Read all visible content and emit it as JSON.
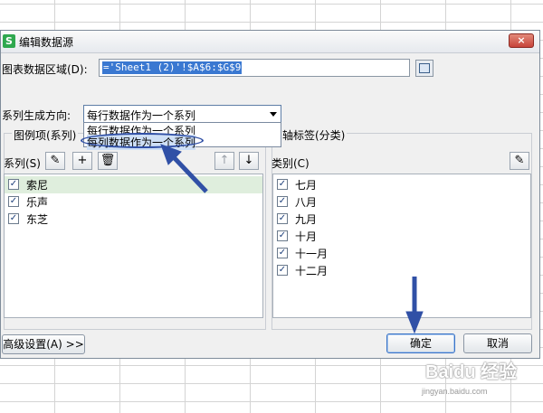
{
  "dialog": {
    "title": "编辑数据源",
    "app_icon_letter": "S",
    "close_label": "×"
  },
  "range": {
    "label": "图表数据区域(D):",
    "value": "='Sheet1 (2)'!$A$6:$G$9"
  },
  "direction": {
    "label": "系列生成方向:",
    "selected": "每行数据作为一个系列",
    "options": [
      "每行数据作为一个系列",
      "每列数据作为一个系列"
    ]
  },
  "legend_group": {
    "title": "图例项(系列)",
    "series_label": "系列(S)",
    "items": [
      {
        "label": "索尼",
        "checked": true,
        "selected": true
      },
      {
        "label": "乐声",
        "checked": true,
        "selected": false
      },
      {
        "label": "东芝",
        "checked": true,
        "selected": false
      }
    ]
  },
  "axis_group": {
    "title": "轴标签(分类)",
    "category_label": "类别(C)",
    "items": [
      {
        "label": "七月",
        "checked": true
      },
      {
        "label": "八月",
        "checked": true
      },
      {
        "label": "九月",
        "checked": true
      },
      {
        "label": "十月",
        "checked": true
      },
      {
        "label": "十一月",
        "checked": true
      },
      {
        "label": "十二月",
        "checked": true
      }
    ]
  },
  "footer": {
    "advanced_label": "高级设置(A) >>",
    "ok_label": "确定",
    "cancel_label": "取消"
  },
  "watermark": {
    "site": "jingyan.baidu.com",
    "brand": "Baidu 经验"
  },
  "colors": {
    "accent": "#3a78d1",
    "annotation": "#3050a6"
  }
}
